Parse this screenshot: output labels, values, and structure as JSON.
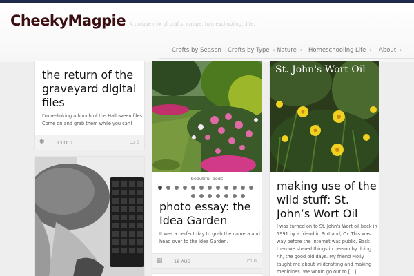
{
  "site": {
    "title": "CheekyMagpie",
    "tagline": "A unique mix of crafts, nature, homeschooling...life."
  },
  "nav": {
    "items": [
      {
        "label": "Crafts by Season"
      },
      {
        "label": "Crafts by Type"
      },
      {
        "label": "Nature"
      },
      {
        "label": "Homeschooling"
      },
      {
        "label": "Life"
      },
      {
        "label": "About"
      }
    ]
  },
  "posts": {
    "graveyard": {
      "title": "the return of the graveyard digital files",
      "excerpt": "I'm re-linking a bunch of the Halloween files. Come on and grab them while you can!",
      "date": "13 OCT",
      "comments": "0",
      "format_icon": "asterisk-icon"
    },
    "idea_garden": {
      "caption": "beautiful beds",
      "title": "photo essay: the Idea Garden",
      "excerpt": "It was a perfect day to grab the camera and head over to the Idea Garden.",
      "date": "16 AUG",
      "comments": "0",
      "format_icon": "gallery-icon"
    },
    "st_johns": {
      "image_text": "St. John's Wort Oil",
      "title": "making use of the wild stuff: St. John’s Wort Oil",
      "excerpt": "I was turned on to St. John's Wort oil back in 1991 by a friend in Portland, Or. This was way before the internet was public. Back then we shared things in person by doing. Ah, the good old days. My friend Molly taught me about wildcrafting and making medicines. We would go out to [...]"
    }
  },
  "slideshow": {
    "dot_count": 19,
    "active_index": 0
  }
}
